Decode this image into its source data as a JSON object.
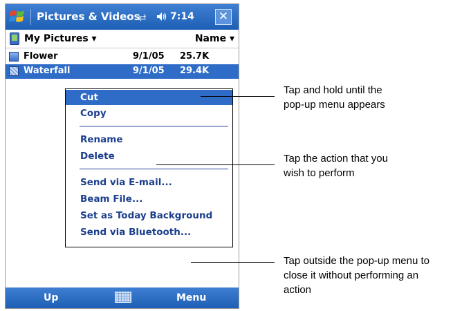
{
  "title_bar": {
    "app_title": "Pictures & Videos",
    "time": "7:14",
    "icons": [
      "windows-start-icon",
      "connectivity-icon",
      "volume-icon",
      "close-icon"
    ],
    "close_glyph": "✕",
    "connectivity_glyph": "⇄",
    "volume_glyph": "◀"
  },
  "folder_bar": {
    "folder": "My Pictures ▾",
    "sort": "Name ▾"
  },
  "files": [
    {
      "name": "Flower",
      "date": "9/1/05",
      "size": "25.7K",
      "selected": false
    },
    {
      "name": "Waterfall",
      "date": "9/1/05",
      "size": "29.4K",
      "selected": true
    }
  ],
  "popup_menu": {
    "group1": [
      "Cut",
      "Copy"
    ],
    "group2": [
      "Rename",
      "Delete"
    ],
    "group3": [
      "Send via E-mail...",
      "Beam File...",
      "Set as Today Background",
      "Send via Bluetooth..."
    ],
    "highlighted": "Cut"
  },
  "menu_bar": {
    "left": "Up",
    "right": "Menu"
  },
  "callouts": [
    {
      "text_line1": "Tap and hold until the",
      "text_line2": "pop-up menu appears"
    },
    {
      "text_line1": "Tap the action that you",
      "text_line2": "wish to perform"
    },
    {
      "text_line1": "Tap outside the pop-up menu to",
      "text_line2": "close it without performing an",
      "text_line3": "action"
    }
  ],
  "colors": {
    "accent": "#2e6cc7",
    "menu_text": "#1b3f8c",
    "bar": "#1d5fb4"
  }
}
